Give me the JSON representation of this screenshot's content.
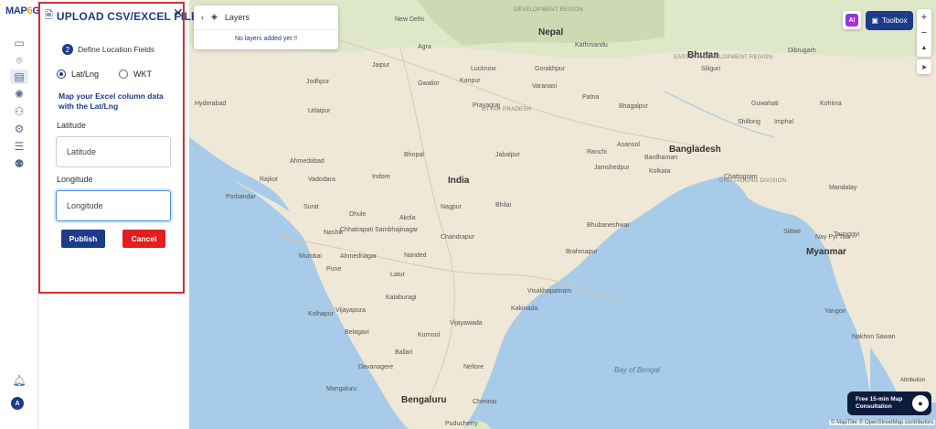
{
  "app": {
    "logo_main": "MAP",
    "logo_accent": "6",
    "logo_tail": "G"
  },
  "rail": {
    "icons": [
      "map-icon",
      "pin-icon",
      "upload-file-icon",
      "settings-icon",
      "people-icon",
      "gear-icon",
      "list-icon",
      "group-icon"
    ],
    "bell_icon": "bell-icon",
    "avatar_letter": "A"
  },
  "upload_panel": {
    "title": "UPLOAD CSV/EXCEL FILE",
    "close": "✕",
    "step_number": "2",
    "step_label": "Define Location Fields",
    "options": [
      {
        "label": "Lat/Lng",
        "selected": true
      },
      {
        "label": "WKT",
        "selected": false
      }
    ],
    "hint": "Map your Excel column data with the Lat/Lng",
    "latitude_label": "Latitude",
    "latitude_placeholder": "Latitude",
    "longitude_label": "Longitude",
    "longitude_placeholder": "Longitude",
    "publish_label": "Publish",
    "cancel_label": "Cancel",
    "accent_color": "#1d3b8b",
    "cancel_color": "#e21e1e",
    "highlight_color": "#d32f2f"
  },
  "layers": {
    "title": "Layers",
    "empty_text": "No layers added yet !!"
  },
  "toolbar": {
    "toolbox_label": "Toolbox",
    "ai_label": "AI",
    "zoom_in": "+",
    "zoom_out": "−",
    "compass": "▲",
    "locate": "➤"
  },
  "map": {
    "cities": [
      {
        "name": "New Delhi",
        "cls": ""
      },
      {
        "name": "Nepal",
        "cls": "big"
      },
      {
        "name": "Kathmandu",
        "cls": ""
      },
      {
        "name": "Bhutan",
        "cls": "big"
      },
      {
        "name": "Jaipur",
        "cls": ""
      },
      {
        "name": "Lucknow",
        "cls": ""
      },
      {
        "name": "Gorakhpur",
        "cls": ""
      },
      {
        "name": "Siliguri",
        "cls": ""
      },
      {
        "name": "Dibrugarh",
        "cls": ""
      },
      {
        "name": "Agra",
        "cls": ""
      },
      {
        "name": "Jodhpur",
        "cls": ""
      },
      {
        "name": "Gwalior",
        "cls": ""
      },
      {
        "name": "Kanpur",
        "cls": ""
      },
      {
        "name": "Varanasi",
        "cls": ""
      },
      {
        "name": "Patna",
        "cls": ""
      },
      {
        "name": "Guwahati",
        "cls": ""
      },
      {
        "name": "Kohima",
        "cls": ""
      },
      {
        "name": "Hyderabad",
        "cls": ""
      },
      {
        "name": "Udaipur",
        "cls": ""
      },
      {
        "name": "Prayagraj",
        "cls": ""
      },
      {
        "name": "Bhagalpur",
        "cls": ""
      },
      {
        "name": "Shillong",
        "cls": ""
      },
      {
        "name": "Imphal",
        "cls": ""
      },
      {
        "name": "Bangladesh",
        "cls": "big"
      },
      {
        "name": "Ranchi",
        "cls": ""
      },
      {
        "name": "Asansol",
        "cls": ""
      },
      {
        "name": "Ahmedabad",
        "cls": ""
      },
      {
        "name": "Bhopal",
        "cls": ""
      },
      {
        "name": "Jabalpur",
        "cls": ""
      },
      {
        "name": "Jamshedpur",
        "cls": ""
      },
      {
        "name": "Kolkata",
        "cls": ""
      },
      {
        "name": "Chattogram",
        "cls": ""
      },
      {
        "name": "Rajkot",
        "cls": ""
      },
      {
        "name": "Vadodara",
        "cls": ""
      },
      {
        "name": "Indore",
        "cls": ""
      },
      {
        "name": "India",
        "cls": "big"
      },
      {
        "name": "Bardhaman",
        "cls": ""
      },
      {
        "name": "Porbandar",
        "cls": ""
      },
      {
        "name": "Surat",
        "cls": ""
      },
      {
        "name": "Nagpur",
        "cls": ""
      },
      {
        "name": "Bhilai",
        "cls": ""
      },
      {
        "name": "Mandalay",
        "cls": ""
      },
      {
        "name": "Dhule",
        "cls": ""
      },
      {
        "name": "Akola",
        "cls": ""
      },
      {
        "name": "Bhubaneshwar",
        "cls": ""
      },
      {
        "name": "Sittwe",
        "cls": ""
      },
      {
        "name": "Taunggyi",
        "cls": ""
      },
      {
        "name": "Nashik",
        "cls": ""
      },
      {
        "name": "Chhatrapati Sambhajinagar",
        "cls": ""
      },
      {
        "name": "Chandrapur",
        "cls": ""
      },
      {
        "name": "Nay Pyi Taw",
        "cls": ""
      },
      {
        "name": "Myanmar",
        "cls": "big"
      },
      {
        "name": "Mumbai",
        "cls": ""
      },
      {
        "name": "Ahmednagar",
        "cls": ""
      },
      {
        "name": "Nanded",
        "cls": ""
      },
      {
        "name": "Brahmapur",
        "cls": ""
      },
      {
        "name": "Pune",
        "cls": ""
      },
      {
        "name": "Latur",
        "cls": ""
      },
      {
        "name": "Visakhapatnam",
        "cls": ""
      },
      {
        "name": "Kolhapur",
        "cls": ""
      },
      {
        "name": "Vijayapura",
        "cls": ""
      },
      {
        "name": "Kalaburagi",
        "cls": ""
      },
      {
        "name": "Kakinada",
        "cls": ""
      },
      {
        "name": "Yangon",
        "cls": ""
      },
      {
        "name": "Belagavi",
        "cls": ""
      },
      {
        "name": "Vijayawada",
        "cls": ""
      },
      {
        "name": "Ballari",
        "cls": ""
      },
      {
        "name": "Kurnool",
        "cls": ""
      },
      {
        "name": "Davanagere",
        "cls": ""
      },
      {
        "name": "Nellore",
        "cls": ""
      },
      {
        "name": "Bay of Bengal",
        "cls": "water"
      },
      {
        "name": "Mangaluru",
        "cls": ""
      },
      {
        "name": "Bengaluru",
        "cls": "big"
      },
      {
        "name": "Chennai",
        "cls": ""
      },
      {
        "name": "Puducherry",
        "cls": ""
      },
      {
        "name": "Nakhon Sawan",
        "cls": ""
      },
      {
        "name": "DEVELOPMENT REGION",
        "cls": "region"
      },
      {
        "name": "EASTERN DEVELOPMENT REGION",
        "cls": "region"
      },
      {
        "name": "UTTAR PRADESH",
        "cls": "region"
      },
      {
        "name": "CHITTAGONG DIVISION",
        "cls": "region"
      }
    ]
  },
  "footer": {
    "consult_line1": "Free 15-min Map",
    "consult_line2": "Consultation",
    "attribution": "© MapTiler © OpenStreetMap contributors",
    "attribution_short": "Attribution"
  }
}
